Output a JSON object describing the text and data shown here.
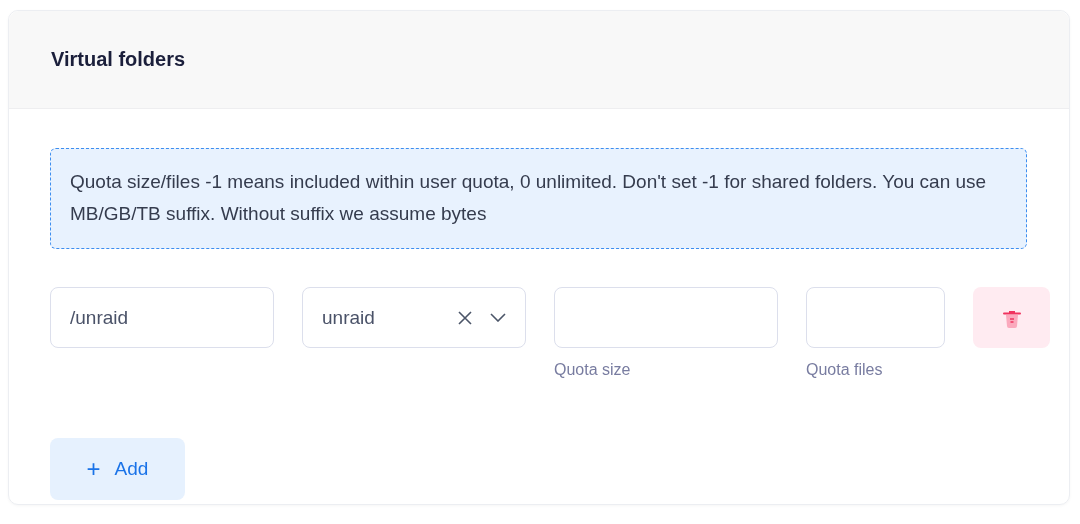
{
  "card": {
    "title": "Virtual folders"
  },
  "notice": "Quota size/files -1 means included within user quota, 0 unlimited. Don't set -1 for shared folders. You can use MB/GB/TB suffix. Without suffix we assume bytes",
  "folders": [
    {
      "path": "/unraid",
      "folder": "unraid",
      "quota_size": {
        "label": "Quota size"
      },
      "quota_files": {
        "label": "Quota files"
      }
    }
  ],
  "add_button": {
    "label": "Add",
    "icon": "+"
  }
}
